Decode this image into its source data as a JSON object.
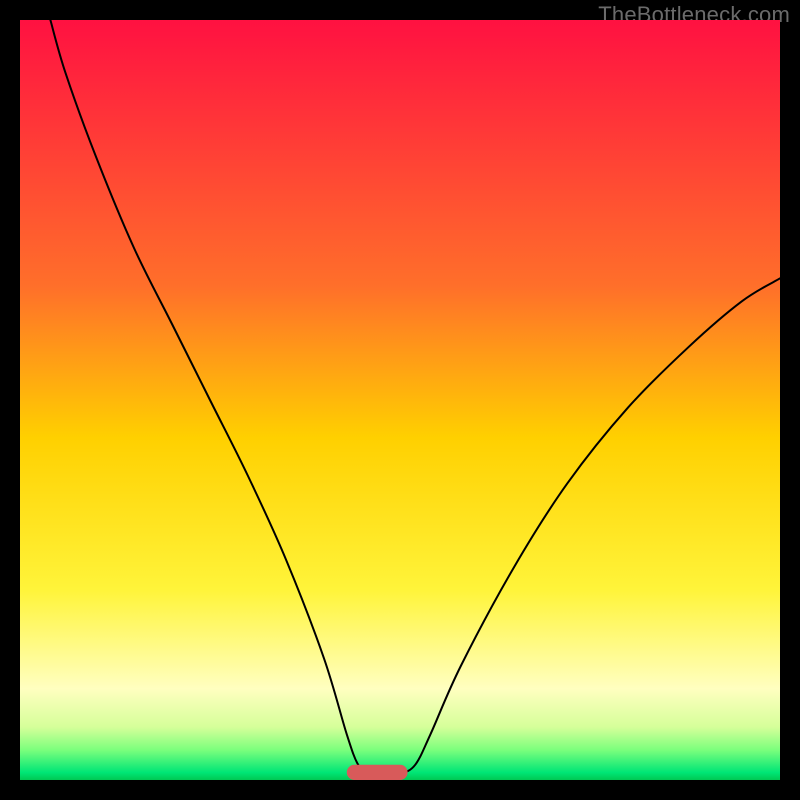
{
  "watermark": "TheBottleneck.com",
  "chart_data": {
    "type": "line",
    "title": "",
    "xlabel": "",
    "ylabel": "",
    "xlim": [
      0,
      100
    ],
    "ylim": [
      0,
      100
    ],
    "grid": false,
    "legend": false,
    "gradient_stops": [
      {
        "offset": 0,
        "color": "#ff1141"
      },
      {
        "offset": 35,
        "color": "#ff6f2a"
      },
      {
        "offset": 55,
        "color": "#ffd000"
      },
      {
        "offset": 75,
        "color": "#fff43a"
      },
      {
        "offset": 88,
        "color": "#ffffc0"
      },
      {
        "offset": 93,
        "color": "#d6ff9a"
      },
      {
        "offset": 96,
        "color": "#7dff7d"
      },
      {
        "offset": 99,
        "color": "#00e676"
      },
      {
        "offset": 100,
        "color": "#00c853"
      }
    ],
    "marker": {
      "x": 47,
      "y": 1,
      "width_pct": 8,
      "height_pct": 2,
      "radius_pct": 1,
      "color": "#d85a5a"
    },
    "series": [
      {
        "name": "curve",
        "stroke": "#000000",
        "stroke_width": 2,
        "points": [
          {
            "x": 4,
            "y": 100
          },
          {
            "x": 6,
            "y": 93
          },
          {
            "x": 10,
            "y": 82
          },
          {
            "x": 15,
            "y": 70
          },
          {
            "x": 20,
            "y": 60
          },
          {
            "x": 25,
            "y": 50
          },
          {
            "x": 30,
            "y": 40
          },
          {
            "x": 35,
            "y": 29
          },
          {
            "x": 40,
            "y": 16
          },
          {
            "x": 43,
            "y": 6
          },
          {
            "x": 44.5,
            "y": 2
          },
          {
            "x": 46,
            "y": 0.8
          },
          {
            "x": 48,
            "y": 0.8
          },
          {
            "x": 50,
            "y": 0.8
          },
          {
            "x": 52,
            "y": 2
          },
          {
            "x": 54,
            "y": 6
          },
          {
            "x": 58,
            "y": 15
          },
          {
            "x": 65,
            "y": 28
          },
          {
            "x": 72,
            "y": 39
          },
          {
            "x": 80,
            "y": 49
          },
          {
            "x": 88,
            "y": 57
          },
          {
            "x": 95,
            "y": 63
          },
          {
            "x": 100,
            "y": 66
          }
        ]
      }
    ]
  }
}
